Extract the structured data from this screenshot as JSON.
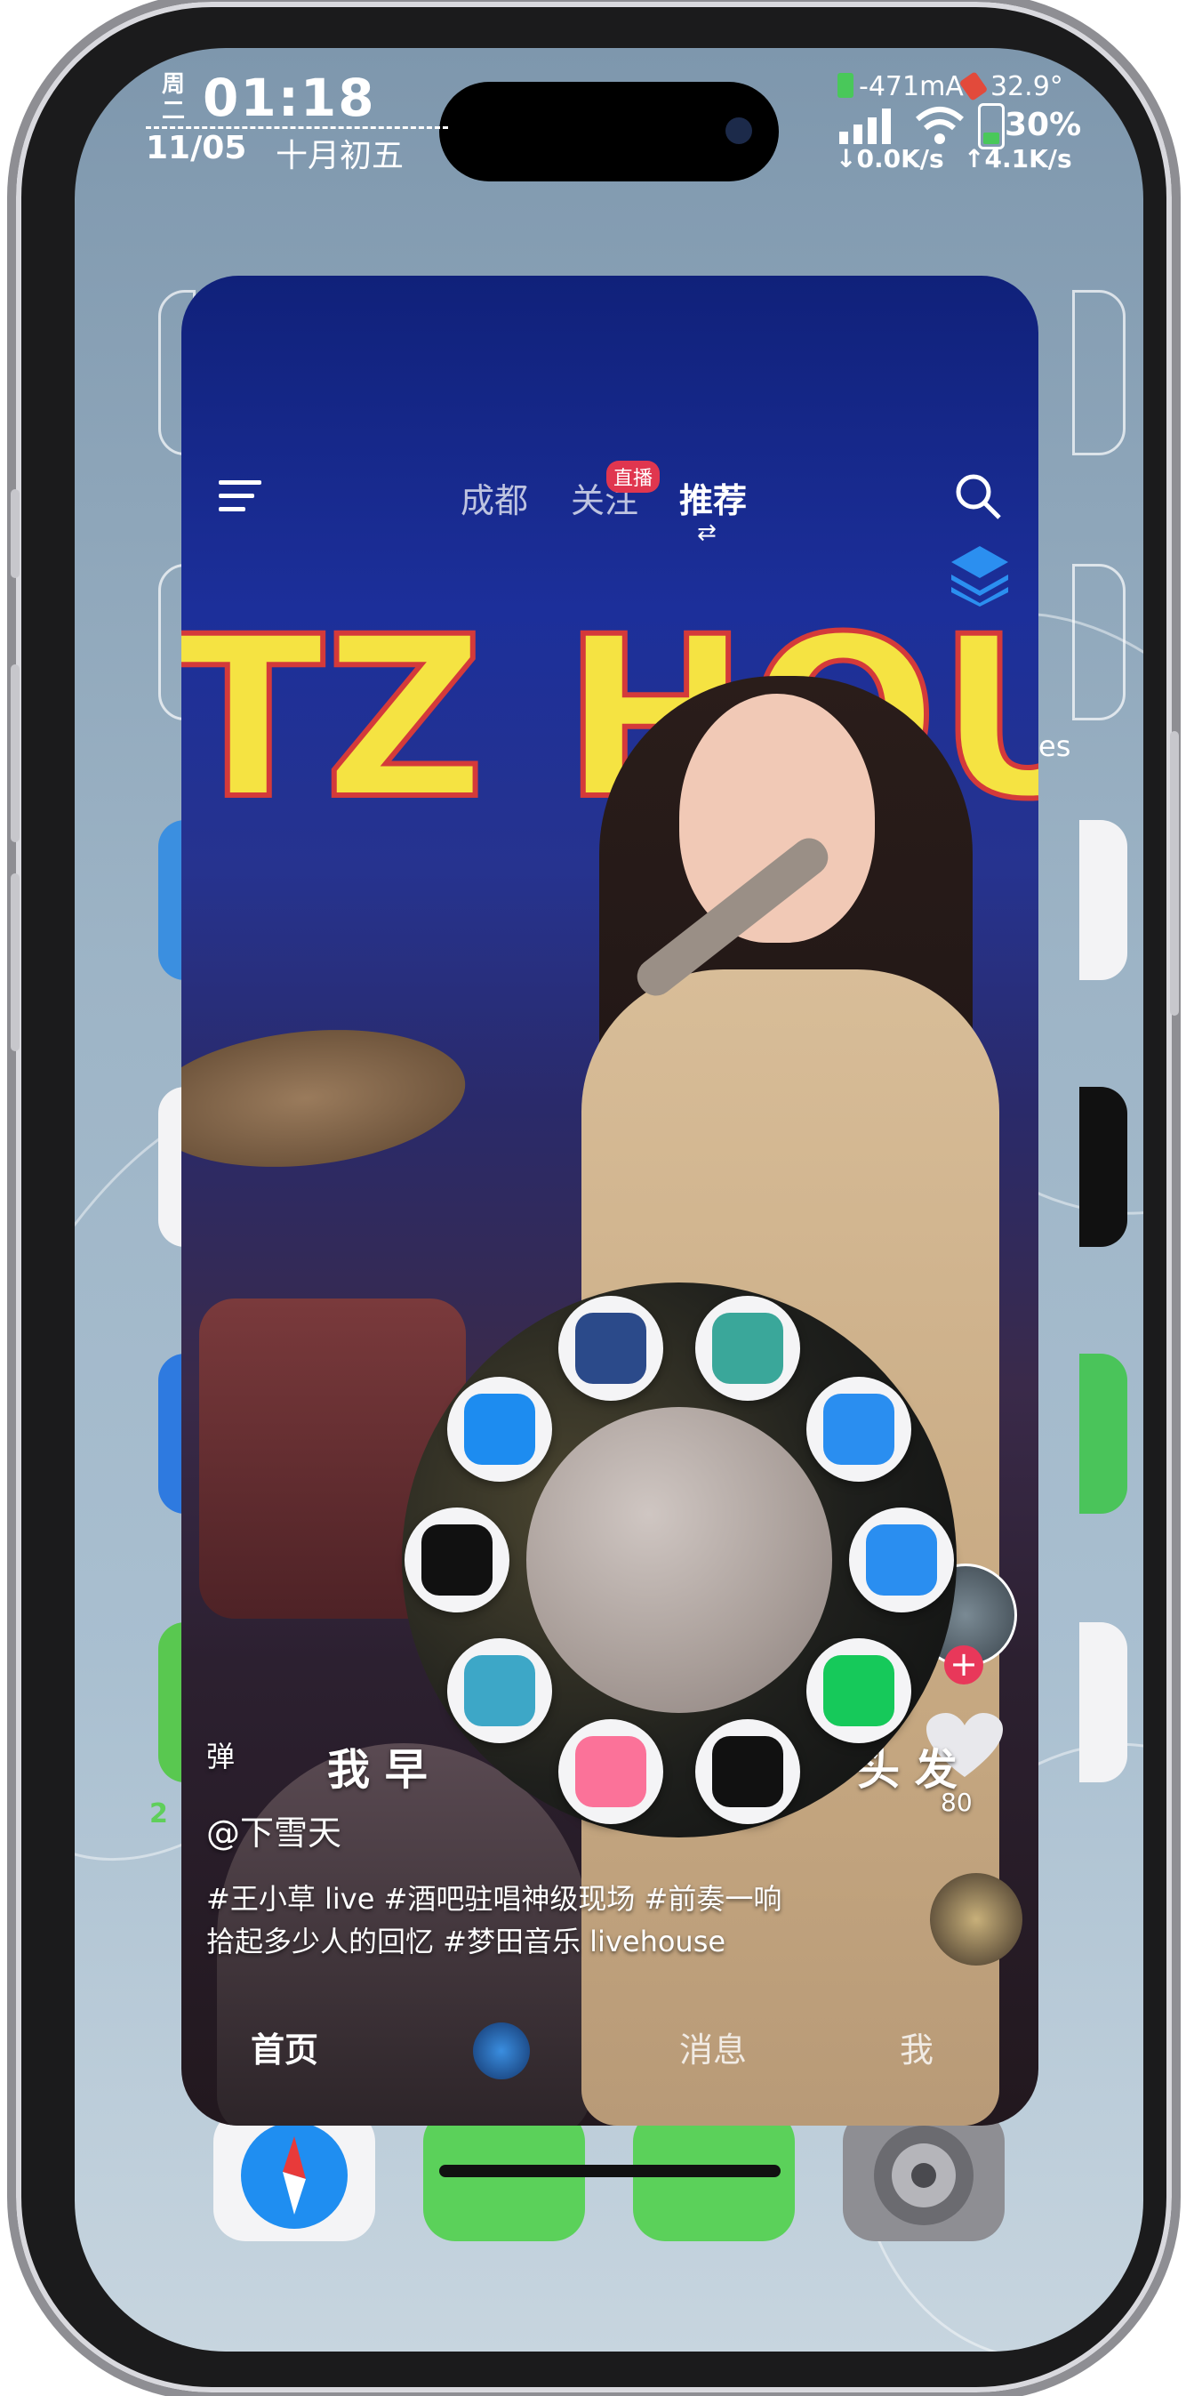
{
  "status_bar": {
    "weekday": "周二",
    "time": "01:18",
    "date": "11/05",
    "lunar_date": "十月初五",
    "current": "-471mA",
    "temperature": "32.9°",
    "battery": "30%",
    "download_speed": "↓0.0K/s",
    "upload_speed": "↑4.1K/s"
  },
  "video_app": {
    "nav_tabs": [
      {
        "label": "成都",
        "active": false
      },
      {
        "label": "关注",
        "active": false,
        "badge": "直播"
      },
      {
        "label": "推荐",
        "active": true
      }
    ],
    "menu_icon": "hamburger-icon",
    "search_icon": "search-icon",
    "layers_icon": "layers-icon",
    "neon_text": "TZ HOUSE",
    "danmaku_label": "弹",
    "overlay_title_left": "我 早",
    "overlay_title_right": "头 发",
    "author": "@下雪天",
    "description_line1": "#王小草 live #酒吧驻唱神级现场 #前奏一响",
    "description_line2": "拾起多少人的回忆 #梦田音乐 livehouse",
    "like_count": "80",
    "tabs": {
      "home": "首页",
      "messages": "消息",
      "me": "我"
    }
  },
  "app_wheel": {
    "apps": [
      {
        "name": "ai-portrait-app-icon",
        "color": "#2b4a8a"
      },
      {
        "name": "circle-app-icon",
        "color": "#3aa79a"
      },
      {
        "name": "files-icon",
        "color": "#2a8ef0"
      },
      {
        "name": "kugou-icon",
        "color": "#2a8ef0"
      },
      {
        "name": "music-note-app-icon",
        "color": "#16c95a"
      },
      {
        "name": "apple-icon",
        "color": "#111111"
      },
      {
        "name": "bilibili-icon",
        "color": "#fb7299"
      },
      {
        "name": "storage-app-icon",
        "color": "#3da7c7"
      },
      {
        "name": "tiktok-icon",
        "color": "#111111"
      },
      {
        "name": "safari-icon",
        "color": "#1d8cf0"
      }
    ]
  },
  "home_screen": {
    "label_fragment": "es",
    "badge_fragment": "2",
    "dock": [
      {
        "name": "safari-dock-icon"
      },
      {
        "name": "messages-dock-icon"
      },
      {
        "name": "phone-dock-icon"
      },
      {
        "name": "settings-dock-icon"
      }
    ]
  }
}
